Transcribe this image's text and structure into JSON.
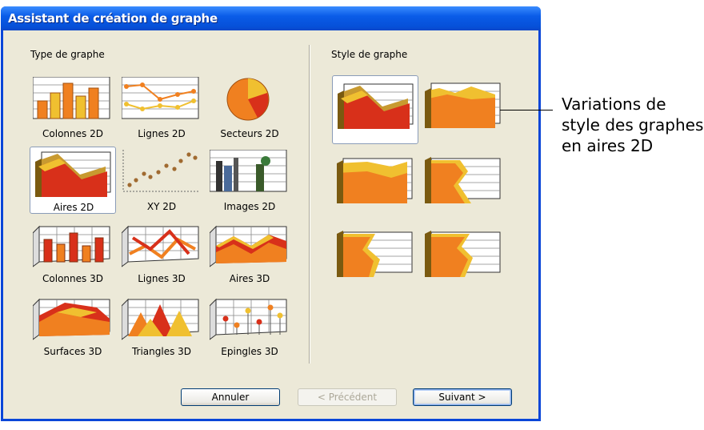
{
  "window": {
    "title": "Assistant de création de graphe"
  },
  "left_panel": {
    "label": "Type de graphe",
    "types": [
      {
        "label": "Colonnes 2D",
        "icon": "columns-2d-icon",
        "selected": false
      },
      {
        "label": "Lignes 2D",
        "icon": "lines-2d-icon",
        "selected": false
      },
      {
        "label": "Secteurs 2D",
        "icon": "pie-2d-icon",
        "selected": false
      },
      {
        "label": "Aires 2D",
        "icon": "areas-2d-icon",
        "selected": true
      },
      {
        "label": "XY 2D",
        "icon": "xy-2d-icon",
        "selected": false
      },
      {
        "label": "Images 2D",
        "icon": "images-2d-icon",
        "selected": false
      },
      {
        "label": "Colonnes 3D",
        "icon": "columns-3d-icon",
        "selected": false
      },
      {
        "label": "Lignes 3D",
        "icon": "lines-3d-icon",
        "selected": false
      },
      {
        "label": "Aires 3D",
        "icon": "areas-3d-icon",
        "selected": false
      },
      {
        "label": "Surfaces 3D",
        "icon": "surfaces-3d-icon",
        "selected": false
      },
      {
        "label": "Triangles 3D",
        "icon": "triangles-3d-icon",
        "selected": false
      },
      {
        "label": "Epingles 3D",
        "icon": "pins-3d-icon",
        "selected": false
      }
    ]
  },
  "right_panel": {
    "label": "Style de graphe",
    "selected_index": 0,
    "style_count": 6
  },
  "buttons": {
    "cancel": "Annuler",
    "previous": "< Précédent",
    "next": "Suivant >"
  },
  "callout": {
    "text": "Variations de\nstyle des graphes\nen aires 2D"
  },
  "colors": {
    "title_bar": "#0a5ce8",
    "dialog_bg": "#ece9d8",
    "orange": "#f08020",
    "red": "#d8301a",
    "yellow": "#f0c030"
  }
}
